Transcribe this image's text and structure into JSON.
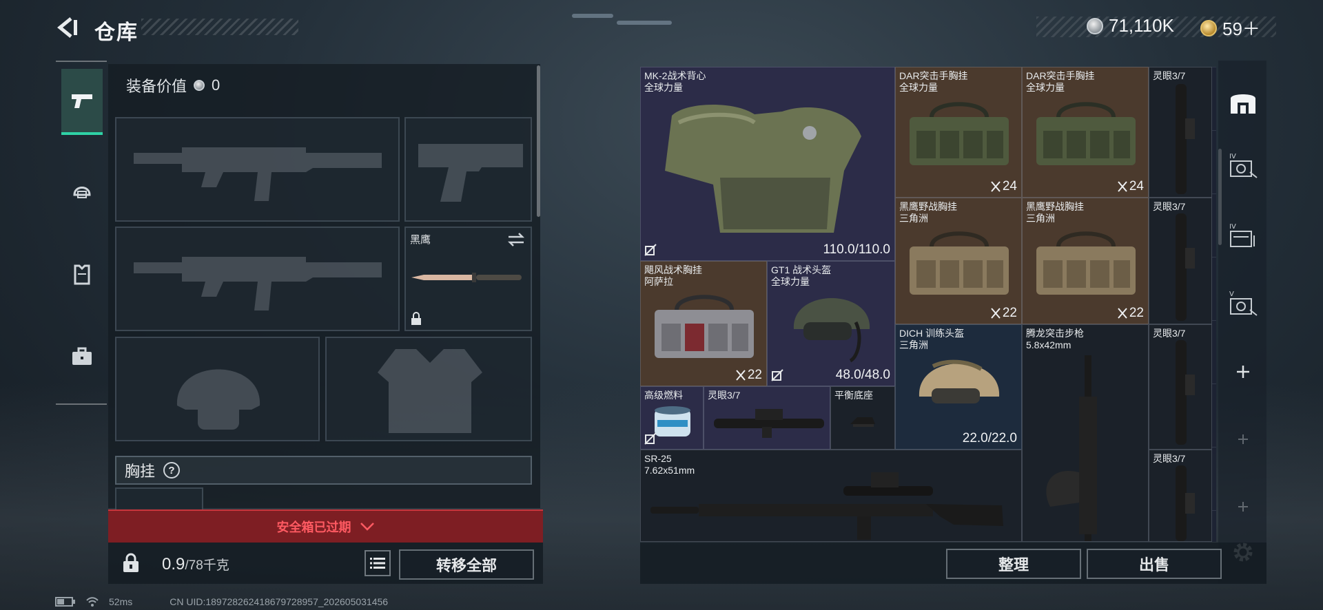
{
  "header": {
    "title": "仓库",
    "currency_silver": "71,110K",
    "currency_gold": "59＋"
  },
  "equipment": {
    "value_label": "装备价值",
    "value": "0",
    "melee_slot_label": "黑鹰",
    "chest_rig_label": "胸挂",
    "chest_rig_help": "?"
  },
  "safe_box": {
    "expired_text": "安全箱已过期"
  },
  "carry": {
    "current": "0.9",
    "capacity": "/78千克",
    "transfer_all_label": "转移全部"
  },
  "warehouse": {
    "items": [
      {
        "line1": "MK-2战术背心",
        "line2": "全球力量",
        "durability": "110.0/110.0"
      },
      {
        "line1": "DAR突击手胸挂",
        "line2": "全球力量",
        "count": "24"
      },
      {
        "line1": "DAR突击手胸挂",
        "line2": "全球力量",
        "count": "24"
      },
      {
        "line1": "灵眼3/7"
      },
      {
        "line1": "黑鹰野战胸挂",
        "line2": "三角洲",
        "count": "22"
      },
      {
        "line1": "黑鹰野战胸挂",
        "line2": "三角洲",
        "count": "22"
      },
      {
        "line1": "灵眼3/7"
      },
      {
        "line1": "飓风战术胸挂",
        "line2": "阿萨拉",
        "count": "22"
      },
      {
        "line1": "GT1 战术头盔",
        "line2": "全球力量",
        "durability": "48.0/48.0"
      },
      {
        "line1": "DICH 训练头盔",
        "line2": "三角洲",
        "durability": "22.0/22.0"
      },
      {
        "line1": "腾龙突击步枪",
        "line2": "5.8x42mm"
      },
      {
        "line1": "灵眼3/7"
      },
      {
        "line1": "高级燃料"
      },
      {
        "line1": "灵眼3/7"
      },
      {
        "line1": "平衡底座"
      },
      {
        "line1": "SR-25",
        "line2": "7.62x51mm"
      },
      {
        "line1": "灵眼3/7"
      }
    ],
    "sort_label": "整理",
    "sell_label": "出售",
    "side_tab_labels": [
      "IV",
      "IV",
      "V"
    ]
  },
  "status_bar": {
    "ping": "52ms",
    "uid": "CN UID:1897282624186797289​57_202605031456"
  },
  "icons": [
    "back-arrow-icon",
    "pistol-icon",
    "helmet-icon",
    "vest-icon",
    "briefcase-icon",
    "lock-icon",
    "list-icon",
    "chevron-down-icon",
    "gear-icon",
    "plus-icon"
  ],
  "colors": {
    "accent_green": "#2fd2a6",
    "expired_red": "#7e1e23",
    "expired_text": "#ff5a62",
    "rarity_brown": "#4b3a2d",
    "rarity_purple": "#2c2c48"
  }
}
